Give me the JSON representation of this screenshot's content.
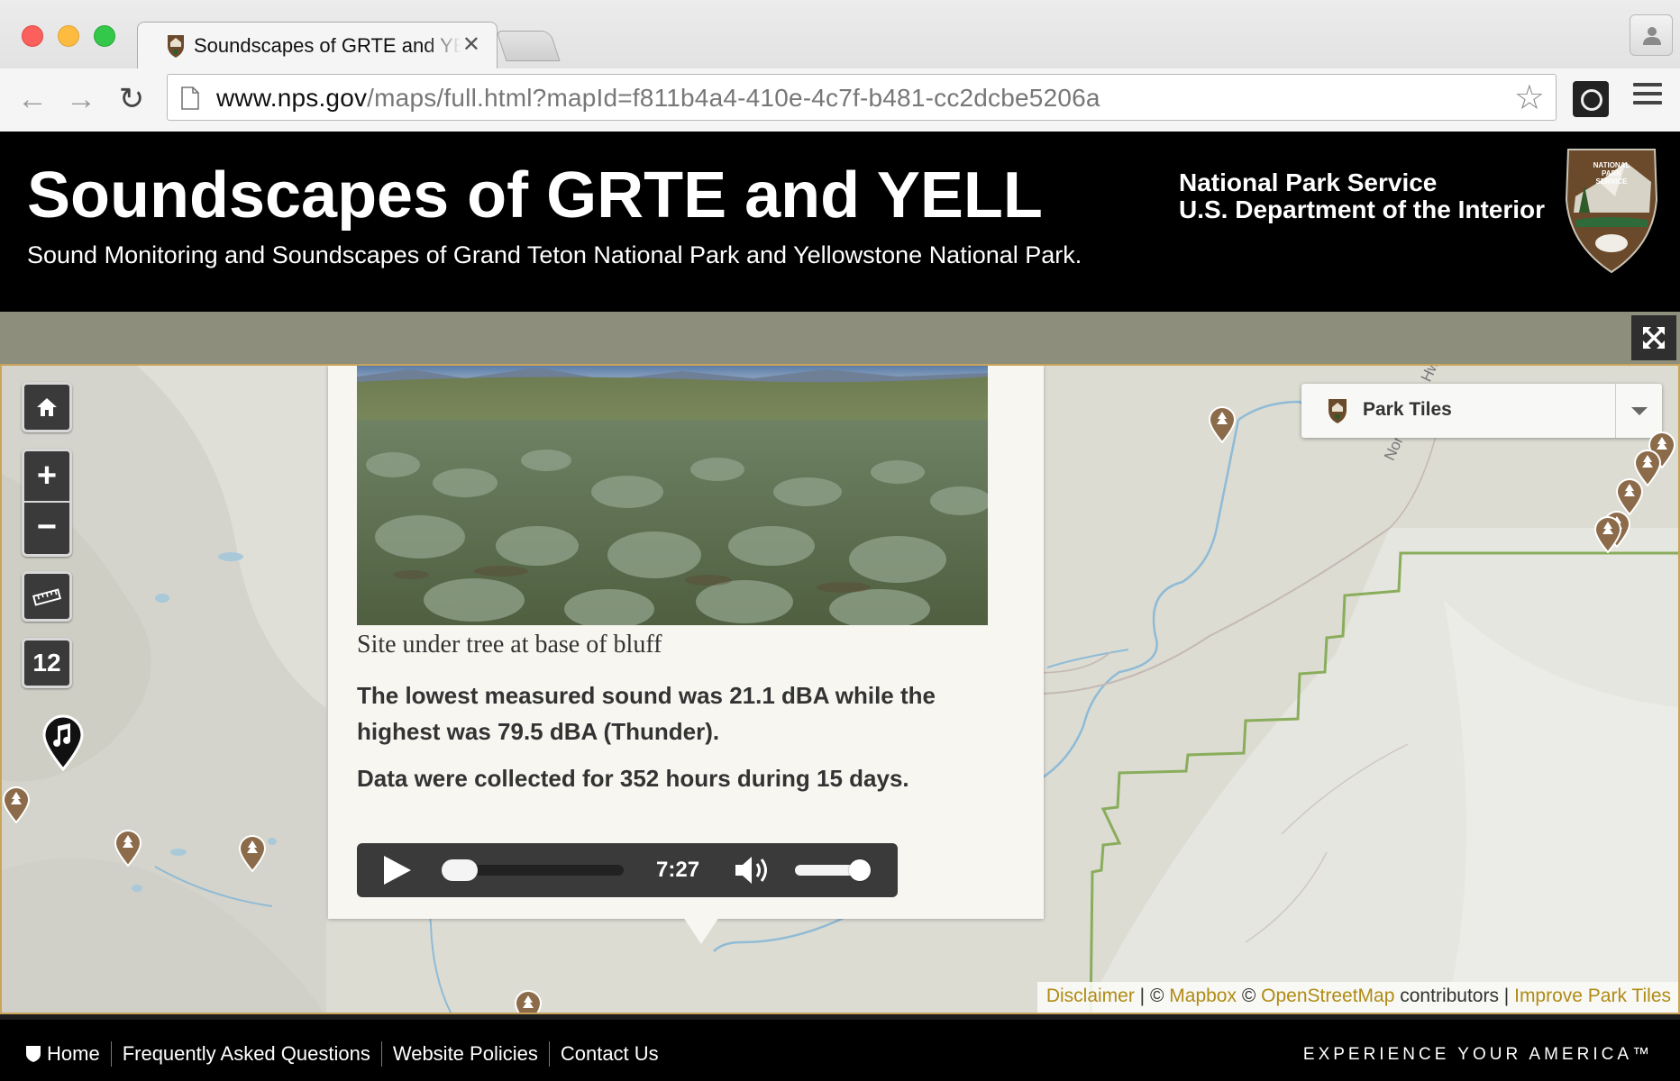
{
  "browser": {
    "tab_title": "Soundscapes of GRTE and YELL",
    "url_host": "www.nps.gov",
    "url_path": "/maps/full.html?mapId=f811b4a4-410e-4c7f-b481-cc2dcbe5206a"
  },
  "header": {
    "title": "Soundscapes of GRTE and YELL",
    "subtitle": "Sound Monitoring and Soundscapes of Grand Teton National Park and Yellowstone National Park.",
    "agency_line1": "National Park Service",
    "agency_line2": "U.S. Department of the Interior",
    "logo_text": "NATIONAL PARK SERVICE"
  },
  "map": {
    "cluster_count": "12",
    "basemap_label": "Park Tiles",
    "road_label": "North-South Hwy",
    "popup": {
      "caption": "Site under tree at base of bluff",
      "stat_lowest": "The lowest measured sound was 21.1 dBA while the highest was 79.5 dBA (Thunder).",
      "stat_duration": "Data were collected for 352 hours during 15 days.",
      "player_time": "7:27",
      "player_progress": 0.0,
      "player_volume": 1.0
    },
    "attribution": {
      "disclaimer": "Disclaimer",
      "sep1": " | © ",
      "mapbox": "Mapbox",
      "sep2": " © ",
      "osm": "OpenStreetMap",
      "contributors": " contributors | ",
      "improve": "Improve Park Tiles"
    }
  },
  "footer": {
    "links": [
      "Home",
      "Frequently Asked Questions",
      "Website Policies",
      "Contact Us"
    ],
    "tagline": "EXPERIENCE YOUR AMERICA™"
  },
  "colors": {
    "header_bg": "#000000",
    "mapbar_bg": "#8e8e7c",
    "link_gold": "#b08b15",
    "boundary_green": "#8aad5c",
    "pin_brown": "#8c6b4a"
  }
}
